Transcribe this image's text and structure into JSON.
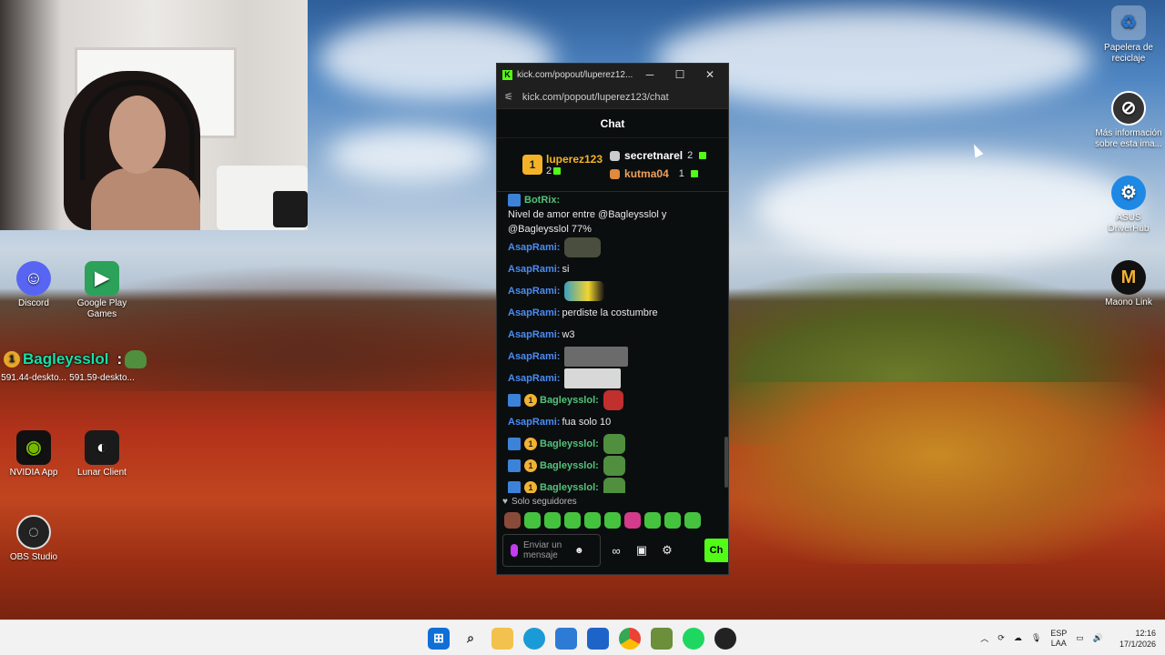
{
  "desktop": {
    "icons_left": [
      {
        "label": "Discord"
      },
      {
        "label": "Google Play Games"
      },
      {
        "label": "591.44-deskto..."
      },
      {
        "label": "591.59-deskto..."
      },
      {
        "label": "NVIDIA App"
      },
      {
        "label": "Lunar Client"
      },
      {
        "label": "OBS Studio"
      }
    ],
    "icons_right": [
      {
        "label": "Papelera de reciclaje"
      },
      {
        "label": "Más información sobre esta ima..."
      },
      {
        "label": "ASUS DriverHub"
      },
      {
        "label": "Maono Link"
      }
    ],
    "overlay": {
      "badge": "1",
      "name": "Bagleysslol",
      "sep": ":"
    }
  },
  "browser": {
    "title": "kick.com/popout/luperez12...",
    "url": "kick.com/popout/luperez123/chat"
  },
  "chat": {
    "header": "Chat",
    "leaderboard": {
      "first": {
        "rank": "1",
        "name": "luperez123",
        "count": "2"
      },
      "second": {
        "name": "secretnarel",
        "count": "2"
      },
      "third": {
        "name": "kutma04",
        "count": "1"
      }
    },
    "messages": [
      {
        "user": "BotRix:",
        "text": "Nivel de amor entre @Bagleysslol y @Bagleysslol 77%",
        "kind": "bot"
      },
      {
        "user": "AsapRami:",
        "text": "",
        "kind": "emote"
      },
      {
        "user": "AsapRami:",
        "text": "si",
        "kind": "text"
      },
      {
        "user": "AsapRami:",
        "text": "",
        "kind": "emote"
      },
      {
        "user": "AsapRami:",
        "text": "perdiste la costumbre",
        "kind": "text"
      },
      {
        "user": "AsapRami:",
        "text": "w3",
        "kind": "text"
      },
      {
        "user": "AsapRami:",
        "text": "",
        "kind": "emote"
      },
      {
        "user": "AsapRami:",
        "text": "",
        "kind": "emote"
      },
      {
        "user": "Bagleysslol:",
        "text": "",
        "kind": "sub-emote"
      },
      {
        "user": "AsapRami:",
        "text": "fua solo 10",
        "kind": "text"
      },
      {
        "user": "Bagleysslol:",
        "text": "",
        "kind": "sub-emote"
      },
      {
        "user": "Bagleysslol:",
        "text": "",
        "kind": "sub-emote"
      },
      {
        "user": "Bagleysslol:",
        "text": "",
        "kind": "sub-emote"
      }
    ],
    "followers_only": "Solo seguidores",
    "input_placeholder": "Enviar un mensaje",
    "send_label": "Ch"
  },
  "taskbar": {
    "lang_top": "ESP",
    "lang_bottom": "LAA",
    "time": "12:16",
    "date": "17/1/2026"
  },
  "colors": {
    "kick_green": "#53fc18",
    "user_blue": "#4b8bf5",
    "user_green": "#53c27a",
    "gold": "#f4b327"
  }
}
